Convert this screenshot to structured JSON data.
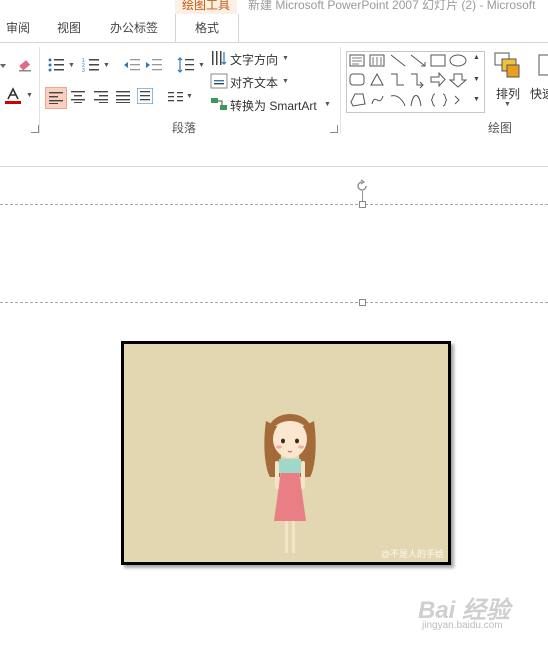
{
  "app": {
    "context_tab_label": "绘图工具",
    "document_title": "新建 Microsoft PowerPoint 2007 幻灯片 (2) - Microsoft"
  },
  "tabs": [
    {
      "label": "审阅"
    },
    {
      "label": "视图"
    },
    {
      "label": "办公标签"
    },
    {
      "label": "格式",
      "active": true
    }
  ],
  "ribbon": {
    "paragraph": {
      "text_direction": "文字方向",
      "align_text": "对齐文本",
      "convert_smartart": "转换为 SmartArt",
      "group_label": "段落"
    },
    "drawing": {
      "arrange": "排列",
      "quick_styles": "快速",
      "group_label": "绘图"
    }
  },
  "slide": {
    "picture_caption": "@不是人的手绘"
  },
  "watermark": {
    "brand": "Bai 经验",
    "url": "jingyan.baidu.com"
  },
  "colors": {
    "context_accent": "#c55a11",
    "font_color_bar": "#d00000",
    "picture_background": "#e2d7b1",
    "active_align": "#f9d0bf"
  }
}
